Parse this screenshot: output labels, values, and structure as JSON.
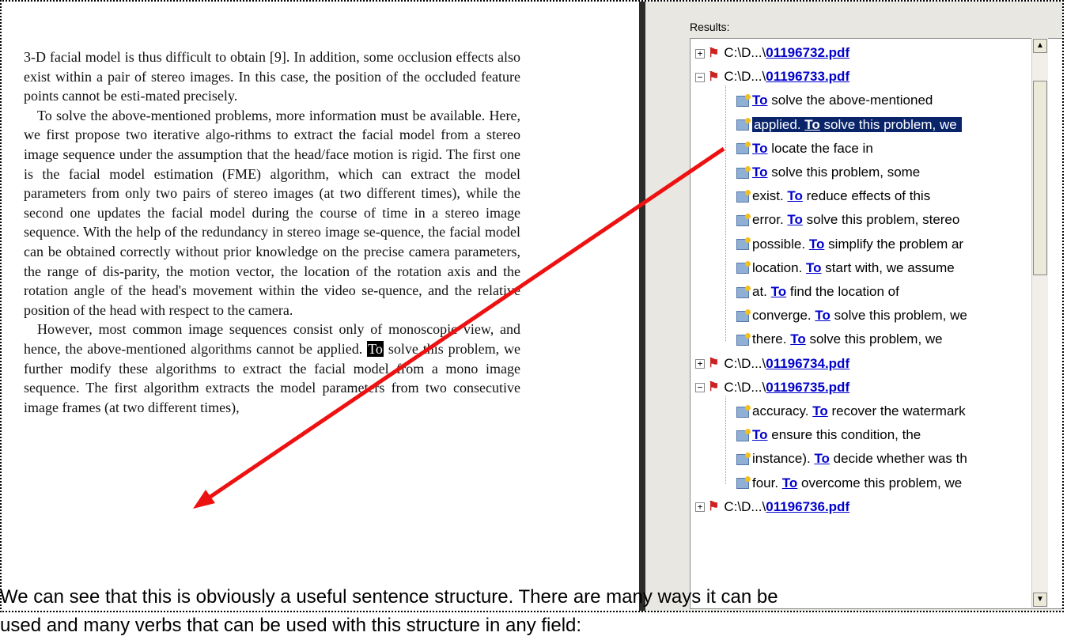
{
  "document": {
    "paragraphs": [
      {
        "text": "3-D facial model is thus difficult to obtain [9]. In addition, some occlusion effects also exist within a pair of stereo images. In this case, the position of the occluded feature points cannot be esti-mated precisely."
      },
      {
        "text": "To solve the above-mentioned problems, more information must be available. Here, we first propose two iterative algo-rithms to extract the facial model from a stereo image sequence under the assumption that the head/face motion is rigid. The first one is the facial model estimation (FME) algorithm, which can extract the model parameters from only two pairs of stereo images (at two different times), while the second one updates the facial model during the course of time in a stereo image sequence. With the help of the redundancy in stereo image se-quence, the facial model can be obtained correctly without prior knowledge on the precise camera parameters, the range of dis-parity, the motion vector, the location of the rotation axis and the rotation angle of the head's movement within the video se-quence, and the relative position of the head with respect to the camera."
      },
      {
        "before": "However, most common image sequences consist only of monoscopic view, and hence, the above-mentioned algorithms cannot be applied. ",
        "highlight": "To",
        "after": " solve this problem, we further modify these algorithms to extract the facial model from a mono image sequence. The first algorithm extracts the model parameters from two consecutive image frames (at two different times),"
      }
    ]
  },
  "results": {
    "label": "Results:",
    "files": [
      {
        "toggle": "+",
        "path": "C:\\D...\\",
        "name": "01196732.pdf"
      },
      {
        "toggle": "−",
        "path": "C:\\D...\\",
        "name": "01196733.pdf",
        "hits": [
          {
            "pre": "",
            "kw": "To",
            "post": " solve the above-mentioned"
          },
          {
            "pre": "applied. ",
            "kw": "To",
            "post": " solve this problem, we",
            "selected": true
          },
          {
            "pre": "",
            "kw": "To",
            "post": " locate the face in"
          },
          {
            "pre": "",
            "kw": "To",
            "post": " solve this problem, some"
          },
          {
            "pre": "exist. ",
            "kw": "To",
            "post": " reduce effects of this"
          },
          {
            "pre": "error. ",
            "kw": "To",
            "post": " solve this problem, stereo"
          },
          {
            "pre": "possible. ",
            "kw": "To",
            "post": " simplify the problem ar"
          },
          {
            "pre": "location. ",
            "kw": "To",
            "post": " start with, we assume"
          },
          {
            "pre": "at. ",
            "kw": "To",
            "post": " find the location of"
          },
          {
            "pre": "converge. ",
            "kw": "To",
            "post": " solve this problem, we"
          },
          {
            "pre": "there. ",
            "kw": "To",
            "post": " solve this problem, we"
          }
        ]
      },
      {
        "toggle": "+",
        "path": "C:\\D...\\",
        "name": "01196734.pdf"
      },
      {
        "toggle": "−",
        "path": "C:\\D...\\",
        "name": "01196735.pdf",
        "hits": [
          {
            "pre": "accuracy. ",
            "kw": "To",
            "post": " recover the watermark"
          },
          {
            "pre": "",
            "kw": "To",
            "post": " ensure this condition, the"
          },
          {
            "pre": "instance). ",
            "kw": "To",
            "post": " decide whether was th"
          },
          {
            "pre": "four. ",
            "kw": "To",
            "post": " overcome this problem, we"
          }
        ]
      },
      {
        "toggle": "+",
        "path": "C:\\D...\\",
        "name": "01196736.pdf"
      }
    ]
  },
  "caption": {
    "line1": "We can see that this is obviously a useful sentence structure. There are many ways it can be",
    "line2": "used and many verbs that can be used with this structure in any field:"
  },
  "colors": {
    "arrow": "#ee1111",
    "selection": "#0a246a",
    "link": "#0000cc"
  }
}
